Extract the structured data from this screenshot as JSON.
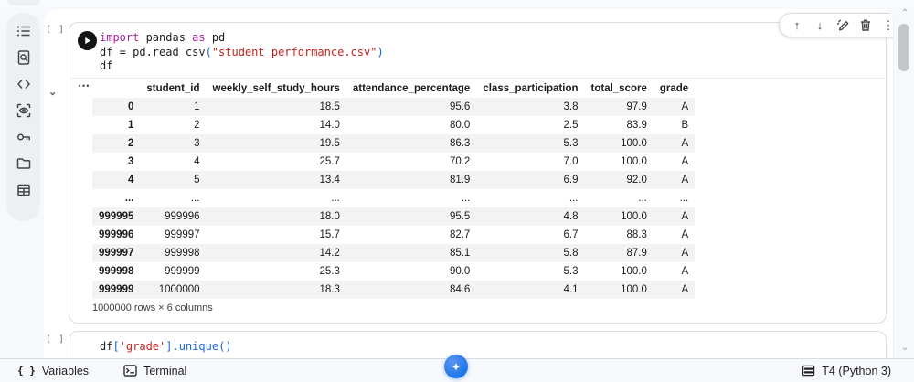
{
  "colors": {
    "accent": "#1a73e8",
    "keyword": "#a625a4",
    "string": "#c5221f",
    "punct": "#1967d2",
    "stripe": "#f3f3f3",
    "page_bg": "#f6f8fc"
  },
  "icons": {
    "up_arrow": "↑",
    "down_arrow": "↓",
    "more_vertical": "⋮",
    "collapse_chevron": "⌄",
    "scroll_up": "⌃",
    "scroll_down": "⌄",
    "output_menu": "⋯",
    "braces": "{ }",
    "gemini_star": "✦"
  },
  "sidebar": {
    "icons": [
      "table-of-contents",
      "find-in-document",
      "code-snippets",
      "scan-eye",
      "secrets-key",
      "files-folder",
      "data-table"
    ]
  },
  "notebook": {
    "cells": [
      {
        "execution_indicator": "[ ]",
        "code": [
          [
            [
              "import",
              "kw"
            ],
            [
              " pandas ",
              "df"
            ],
            [
              "as",
              "kw"
            ],
            [
              " pd",
              "df"
            ]
          ],
          [
            [
              "df = pd.read_csv",
              "df"
            ],
            [
              "(",
              "pn"
            ],
            [
              "\"student_performance.csv\"",
              "st"
            ],
            [
              ")",
              "pn"
            ]
          ],
          [
            [
              "df",
              "df"
            ]
          ]
        ],
        "output": {
          "table": {
            "columns": [
              "",
              "student_id",
              "weekly_self_study_hours",
              "attendance_percentage",
              "class_participation",
              "total_score",
              "grade"
            ],
            "rows": [
              [
                "0",
                "1",
                "18.5",
                "95.6",
                "3.8",
                "97.9",
                "A"
              ],
              [
                "1",
                "2",
                "14.0",
                "80.0",
                "2.5",
                "83.9",
                "B"
              ],
              [
                "2",
                "3",
                "19.5",
                "86.3",
                "5.3",
                "100.0",
                "A"
              ],
              [
                "3",
                "4",
                "25.7",
                "70.2",
                "7.0",
                "100.0",
                "A"
              ],
              [
                "4",
                "5",
                "13.4",
                "81.9",
                "6.9",
                "92.0",
                "A"
              ],
              [
                "...",
                "...",
                "...",
                "...",
                "...",
                "...",
                "..."
              ],
              [
                "999995",
                "999996",
                "18.0",
                "95.5",
                "4.8",
                "100.0",
                "A"
              ],
              [
                "999996",
                "999997",
                "15.7",
                "82.7",
                "6.7",
                "88.3",
                "A"
              ],
              [
                "999997",
                "999998",
                "14.2",
                "85.1",
                "5.8",
                "87.9",
                "A"
              ],
              [
                "999998",
                "999999",
                "25.3",
                "90.0",
                "5.3",
                "100.0",
                "A"
              ],
              [
                "999999",
                "1000000",
                "18.3",
                "84.6",
                "4.1",
                "100.0",
                "A"
              ]
            ],
            "summary": "1000000 rows × 6 columns"
          }
        }
      },
      {
        "execution_indicator": "[ ]",
        "code": [
          [
            [
              "df",
              "df"
            ],
            [
              "[",
              "pn"
            ],
            [
              "'grade'",
              "st"
            ],
            [
              "]",
              "pn"
            ],
            [
              ".unique",
              "fn"
            ],
            [
              "(",
              "pn"
            ],
            [
              ")",
              "pn"
            ]
          ]
        ]
      }
    ]
  },
  "cell_toolbar": {
    "buttons": [
      "move-cell-up",
      "move-cell-down",
      "edit-cell",
      "delete-cell",
      "more-options"
    ]
  },
  "bottom_bar": {
    "variables": "Variables",
    "terminal": "Terminal",
    "runtime": "T4 (Python 3)"
  }
}
